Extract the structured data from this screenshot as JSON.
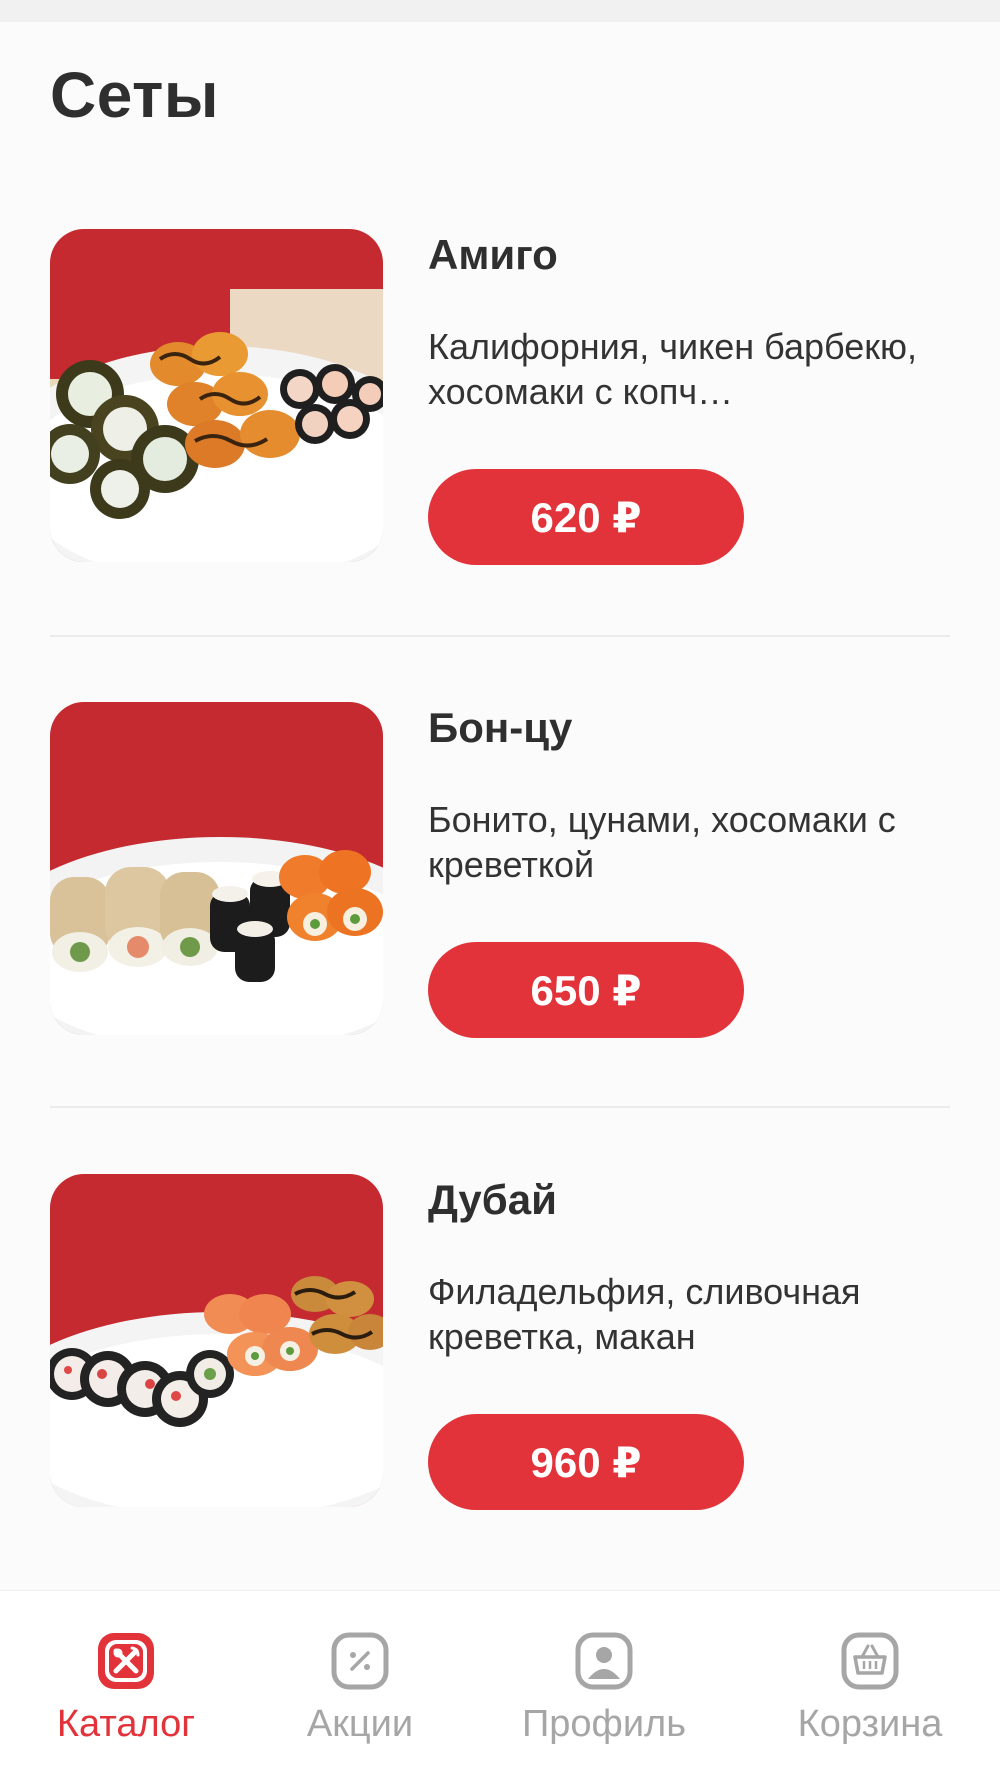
{
  "page": {
    "title": "Сеты"
  },
  "items": [
    {
      "name": "Амиго",
      "description": "Калифорния, чикен барбекю, хосомаки с копч…",
      "price": "620 ₽"
    },
    {
      "name": "Бон-цу",
      "description": "Бонито, цунами, хосомаки с креветкой",
      "price": "650 ₽"
    },
    {
      "name": "Дубай",
      "description": "Филадельфия, сливочная креветка, макан",
      "price": "960 ₽"
    }
  ],
  "tabbar": {
    "tabs": [
      {
        "label": "Каталог",
        "icon": "catalog-fork-knife-icon",
        "active": true
      },
      {
        "label": "Акции",
        "icon": "discount-percent-icon",
        "active": false
      },
      {
        "label": "Профиль",
        "icon": "profile-user-icon",
        "active": false
      },
      {
        "label": "Корзина",
        "icon": "cart-basket-icon",
        "active": false
      }
    ]
  },
  "colors": {
    "accent": "#e3333a",
    "inactive": "#a6a6a6",
    "text": "#2f2f2f",
    "photo_background": "#c52a30"
  }
}
